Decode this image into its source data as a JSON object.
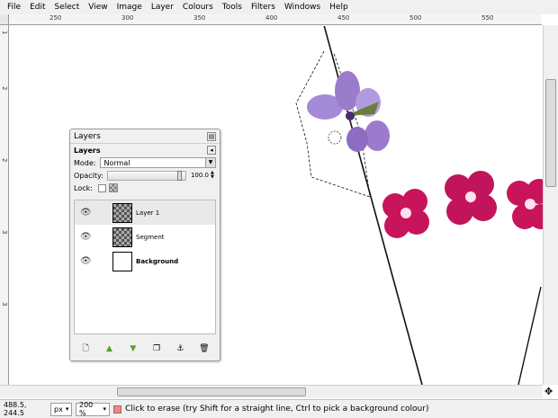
{
  "menu": [
    "File",
    "Edit",
    "Select",
    "View",
    "Image",
    "Layer",
    "Colours",
    "Tools",
    "Filters",
    "Windows",
    "Help"
  ],
  "ruler": {
    "top_labels": [
      "250",
      "300",
      "350",
      "400",
      "450",
      "500",
      "550"
    ],
    "left_labels": [
      "1",
      "2",
      "2",
      "3",
      "3"
    ]
  },
  "layers_dock": {
    "title": "Layers",
    "subtitle": "Layers",
    "mode_label": "Mode:",
    "mode_value": "Normal",
    "opacity_label": "Opacity:",
    "opacity_value": "100.0",
    "lock_label": "Lock:",
    "layers": [
      {
        "name": "Layer 1",
        "thumb": "checker",
        "selected": true
      },
      {
        "name": "Segment",
        "thumb": "checker",
        "selected": false
      },
      {
        "name": "Background",
        "thumb": "white",
        "selected": false
      }
    ],
    "bottom_icons": [
      "new-layer-icon",
      "raise-layer-icon",
      "lower-layer-icon",
      "duplicate-layer-icon",
      "anchor-icon",
      "delete-icon"
    ]
  },
  "status": {
    "coords": "488.5, 244.5",
    "unit": "px",
    "zoom": "200 %",
    "message": "Click to erase (try Shift for a straight line, Ctrl to pick a background colour)"
  },
  "colors": {
    "flower_pink": "#c8145a",
    "flower_violet": "#9a7bcc"
  }
}
